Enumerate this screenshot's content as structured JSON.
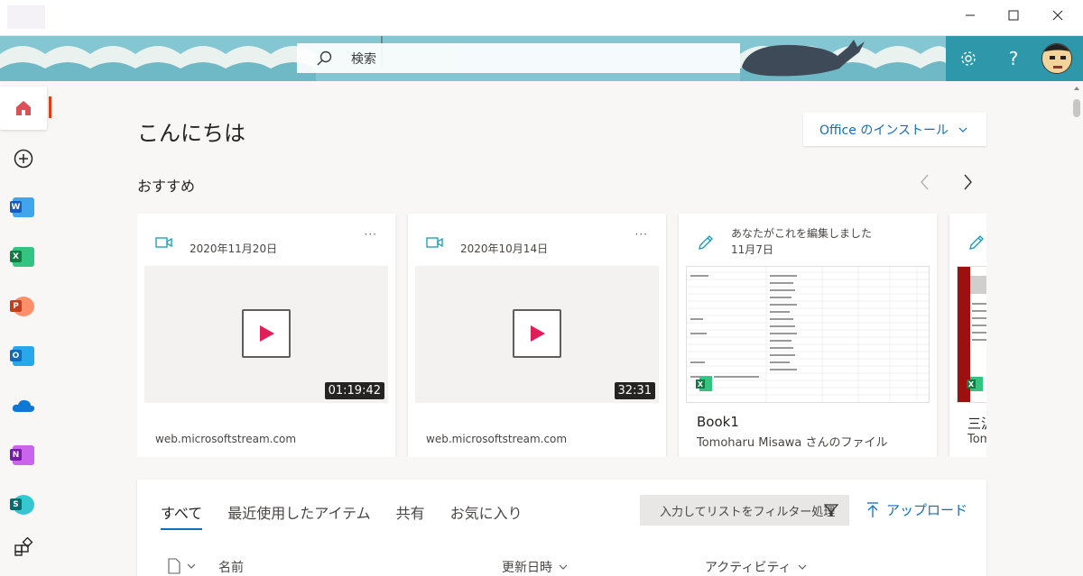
{
  "window": {
    "minimize_icon": "minimize-icon",
    "maximize_icon": "maximize-icon",
    "close_icon": "close-icon"
  },
  "header": {
    "search_placeholder": "検索",
    "settings_icon": "gear-icon",
    "help_label": "?",
    "accent": "#2f97aa"
  },
  "rail": {
    "items": [
      {
        "name": "home",
        "icon": "home-icon"
      },
      {
        "name": "create",
        "icon": "plus-circle-icon"
      },
      {
        "name": "word",
        "letter": "W",
        "color": "#185abd"
      },
      {
        "name": "excel",
        "letter": "X",
        "color": "#107c41"
      },
      {
        "name": "powerpoint",
        "letter": "P",
        "color": "#c43e1c"
      },
      {
        "name": "outlook",
        "letter": "O",
        "color": "#0f6cbd"
      },
      {
        "name": "onedrive",
        "icon": "cloud-icon"
      },
      {
        "name": "onenote",
        "letter": "N",
        "color": "#7719aa"
      },
      {
        "name": "sharepoint",
        "letter": "S",
        "color": "#036c70"
      },
      {
        "name": "all-apps",
        "icon": "apps-icon"
      }
    ]
  },
  "main": {
    "greeting": "こんにちは",
    "install_label": "Office のインストール",
    "recommended_title": "おすすめ",
    "cards": [
      {
        "type": "video",
        "date": "2020年11月20日",
        "more": "···",
        "duration": "01:19:42",
        "source": "web.microsoftstream.com"
      },
      {
        "type": "video",
        "date": "2020年10月14日",
        "more": "···",
        "duration": "32:31",
        "source": "web.microsoftstream.com"
      },
      {
        "type": "excel",
        "line1": "あなたがこれを編集しました",
        "line2": "11月7日",
        "name": "Book1",
        "owner": "Tomoharu Misawa さんのファイル"
      },
      {
        "type": "excel",
        "name": "三沢",
        "owner": "Tom"
      }
    ],
    "tabs": [
      "すべて",
      "最近使用したアイテム",
      "共有",
      "お気に入り"
    ],
    "filter_placeholder": "入力してリストをフィルター処理",
    "upload_label": "アップロード",
    "columns": {
      "name": "名前",
      "modified": "更新日時",
      "activity": "アクティビティ"
    }
  }
}
